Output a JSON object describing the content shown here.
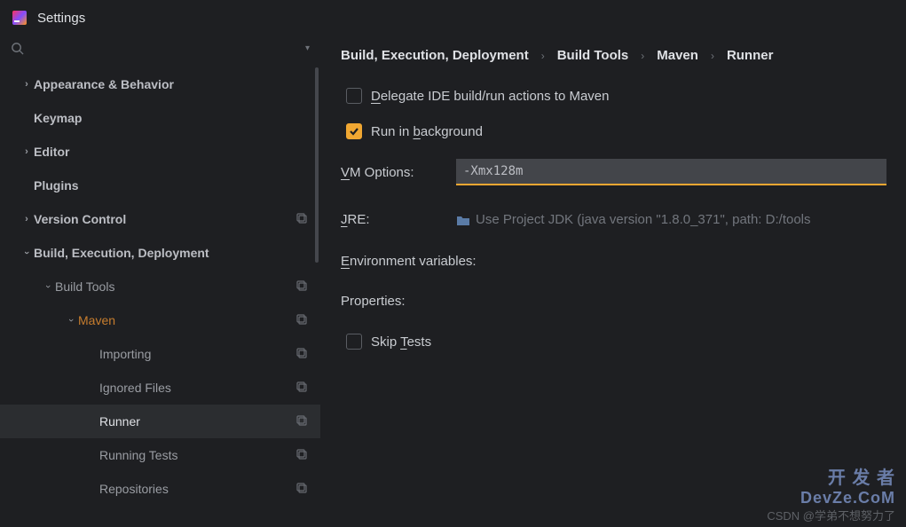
{
  "window": {
    "title": "Settings"
  },
  "search": {
    "placeholder": ""
  },
  "sidebar": {
    "items": [
      {
        "label": "Appearance & Behavior"
      },
      {
        "label": "Keymap"
      },
      {
        "label": "Editor"
      },
      {
        "label": "Plugins"
      },
      {
        "label": "Version Control"
      },
      {
        "label": "Build, Execution, Deployment"
      },
      {
        "label": "Build Tools"
      },
      {
        "label": "Maven"
      },
      {
        "label": "Importing"
      },
      {
        "label": "Ignored Files"
      },
      {
        "label": "Runner"
      },
      {
        "label": "Running Tests"
      },
      {
        "label": "Repositories"
      }
    ]
  },
  "breadcrumb": {
    "a": "Build, Execution, Deployment",
    "b": "Build Tools",
    "c": "Maven",
    "d": "Runner"
  },
  "form": {
    "delegate_prefix": "D",
    "delegate_rest": "elegate IDE build/run actions to Maven",
    "runbg_pre": "Run in ",
    "runbg_u": "b",
    "runbg_post": "ackground",
    "vm_u": "V",
    "vm_rest": "M Options:",
    "vm_value": "-Xmx128m",
    "jre_u": "J",
    "jre_rest": "RE:",
    "jre_value": "Use Project JDK (java version \"1.8.0_371\", path: D:/tools",
    "env_u": "E",
    "env_rest": "nvironment variables:",
    "props": "Properties:",
    "skip_pre": "Skip ",
    "skip_u": "T",
    "skip_post": "ests"
  },
  "watermark": {
    "line1": "开 发 者",
    "line2": "DevZe.CoM",
    "csdn": "CSDN @学弟不想努力了"
  }
}
